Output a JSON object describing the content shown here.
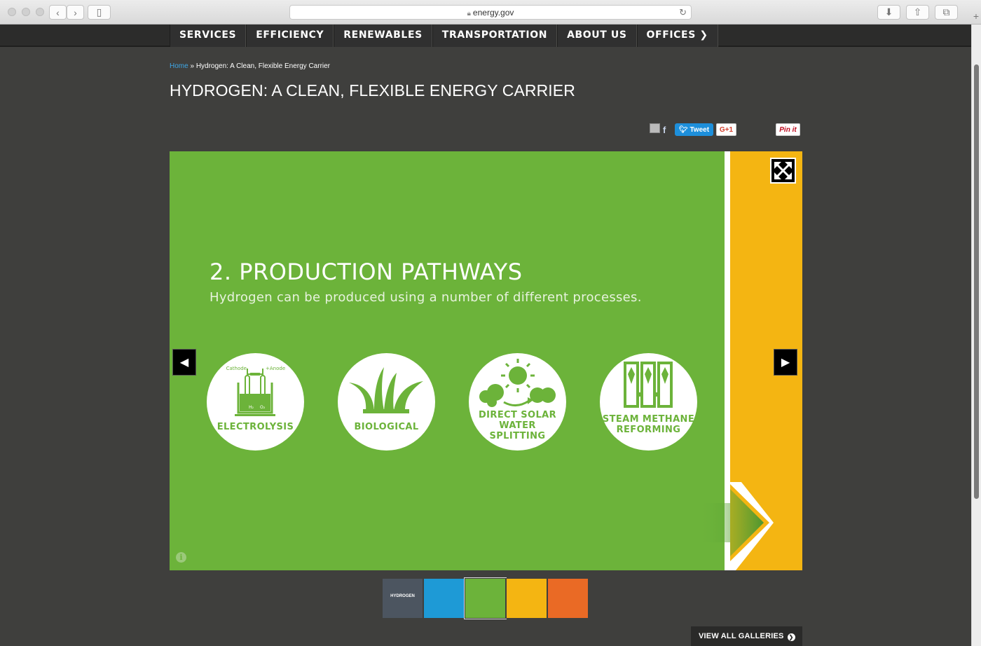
{
  "browser": {
    "url": "energy.gov"
  },
  "nav": {
    "items": [
      "SERVICES",
      "EFFICIENCY",
      "RENEWABLES",
      "TRANSPORTATION",
      "ABOUT US",
      "OFFICES"
    ]
  },
  "breadcrumb": {
    "home": "Home",
    "separator": "»",
    "current": "Hydrogen: A Clean, Flexible Energy Carrier"
  },
  "page": {
    "title": "HYDROGEN: A CLEAN, FLEXIBLE ENERGY CARRIER"
  },
  "share": {
    "tweet": "Tweet",
    "gplus": "G+1",
    "pin": "Pin it"
  },
  "slide": {
    "title": "2. PRODUCTION PATHWAYS",
    "subtitle": "Hydrogen can be produced using a number of different processes.",
    "pathways": [
      {
        "label": "ELECTROLYSIS",
        "cathode": "Cathode",
        "anode": "+Anode",
        "h2": "H₂",
        "o2": "O₂"
      },
      {
        "label": "BIOLOGICAL"
      },
      {
        "label_lines": [
          "DIRECT SOLAR",
          "WATER",
          "SPLITTING"
        ]
      },
      {
        "label_lines": [
          "STEAM METHANE",
          "REFORMING"
        ]
      }
    ],
    "colors": {
      "green": "#6cb33a",
      "yellow": "#f4b512"
    }
  },
  "thumbnails": [
    {
      "text": "HYDROGEN",
      "color": "#4c5560"
    },
    {
      "text": "",
      "color": "#1e9ad6"
    },
    {
      "text": "",
      "color": "#6cb33a"
    },
    {
      "text": "",
      "color": "#f4b512"
    },
    {
      "text": "",
      "color": "#ea6a25"
    }
  ],
  "footer": {
    "view_all": "VIEW ALL GALLERIES"
  }
}
